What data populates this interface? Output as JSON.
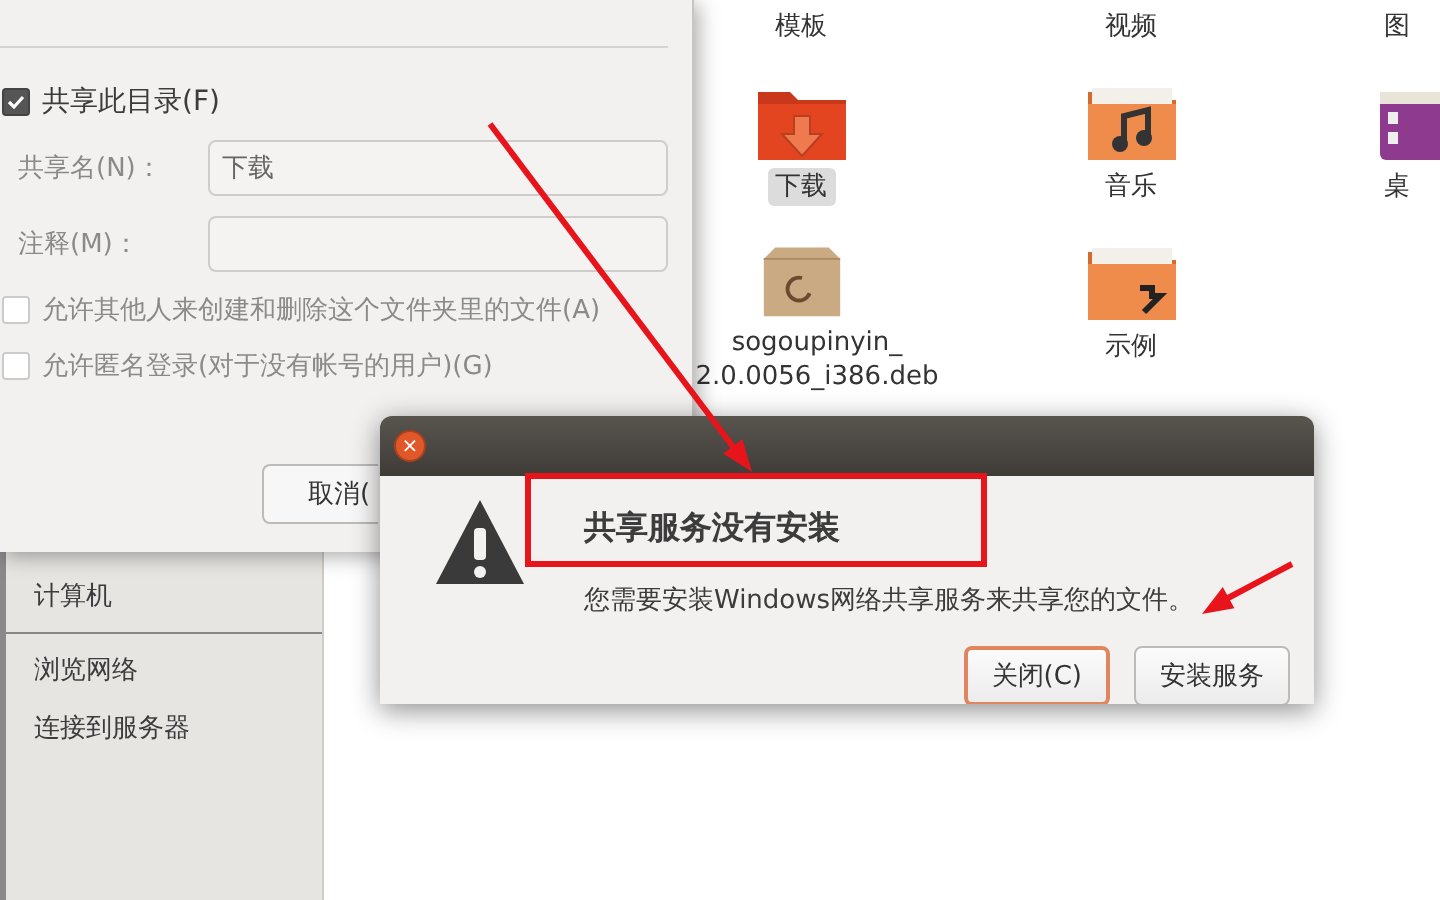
{
  "file_manager": {
    "sidebar": {
      "items": [
        {
          "label": "计算机",
          "selected": false
        },
        {
          "label": "浏览网络",
          "selected": false
        },
        {
          "label": "连接到服务器",
          "selected": false
        }
      ]
    },
    "files": [
      {
        "name": "模板",
        "kind": "template",
        "selected": false
      },
      {
        "name": "视频",
        "kind": "video",
        "selected": false
      },
      {
        "name": "图",
        "kind": "pictures",
        "selected": false
      },
      {
        "name": "下载",
        "kind": "download",
        "selected": true
      },
      {
        "name": "音乐",
        "kind": "music",
        "selected": false
      },
      {
        "name": "桌",
        "kind": "desktop",
        "selected": false
      },
      {
        "name": "sogoupinyin_\n2.0.0056_i386.deb",
        "kind": "package",
        "selected": false
      },
      {
        "name": "示例",
        "kind": "examples",
        "selected": false
      }
    ]
  },
  "share_dialog": {
    "share_folder": {
      "label": "共享此目录(F)",
      "checked": true
    },
    "fields": [
      {
        "label": "共享名(N)：",
        "value": "下载",
        "disabled": true
      },
      {
        "label": "注释(M)：",
        "disabled": true
      }
    ],
    "options": [
      {
        "label": "允许其他人来创建和删除这个文件夹里的文件(A)",
        "checked": false,
        "disabled": true
      },
      {
        "label": "允许匿名登录(对于没有帐号的用户)(G)",
        "checked": false,
        "disabled": true
      }
    ],
    "buttons": [
      "取消("
    ]
  },
  "alert": {
    "close": "×",
    "heading": "共享服务没有安装",
    "message": "您需要安装Windows网络共享服务来共享您的文件。",
    "buttons": [
      {
        "label": "关闭(C)",
        "default": true
      },
      {
        "label": "安装服务",
        "default": false
      }
    ]
  }
}
